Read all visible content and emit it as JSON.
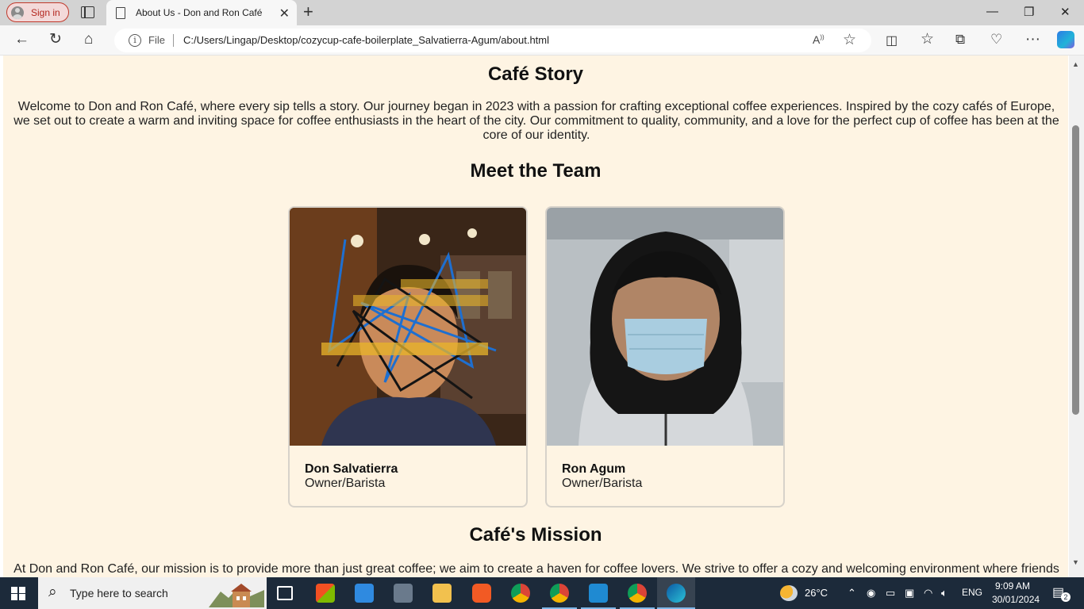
{
  "browser": {
    "signin_label": "Sign in",
    "tab_title": "About Us - Don and Ron Café",
    "address_prefix": "File",
    "url": "C:/Users/Lingap/Desktop/cozycup-cafe-boilerplate_Salvatierra-Agum/about.html"
  },
  "page": {
    "story_heading": "Café Story",
    "story_text": "Welcome to Don and Ron Café, where every sip tells a story. Our journey began in 2023 with a passion for crafting exceptional coffee experiences. Inspired by the cozy cafés of Europe, we set out to create a warm and inviting space for coffee enthusiasts in the heart of the city. Our commitment to quality, community, and a love for the perfect cup of coffee has been at the core of our identity.",
    "team_heading": "Meet the Team",
    "team": [
      {
        "name": "Don Salvatierra",
        "role": "Owner/Barista"
      },
      {
        "name": "Ron Agum",
        "role": "Owner/Barista"
      }
    ],
    "mission_heading": "Café's Mission",
    "mission_text": "At Don and Ron Café, our mission is to provide more than just great coffee; we aim to create a haven for coffee lovers. We strive to offer a cozy and welcoming environment where friends"
  },
  "taskbar": {
    "search_placeholder": "Type here to search",
    "weather": "26°C",
    "language": "ENG",
    "time": "9:09 AM",
    "date": "30/01/2024",
    "notifications": "2"
  },
  "colors": {
    "page_background": "#fef4e3",
    "signin_accent": "#b3261e",
    "taskbar": "#1c2a3a"
  }
}
